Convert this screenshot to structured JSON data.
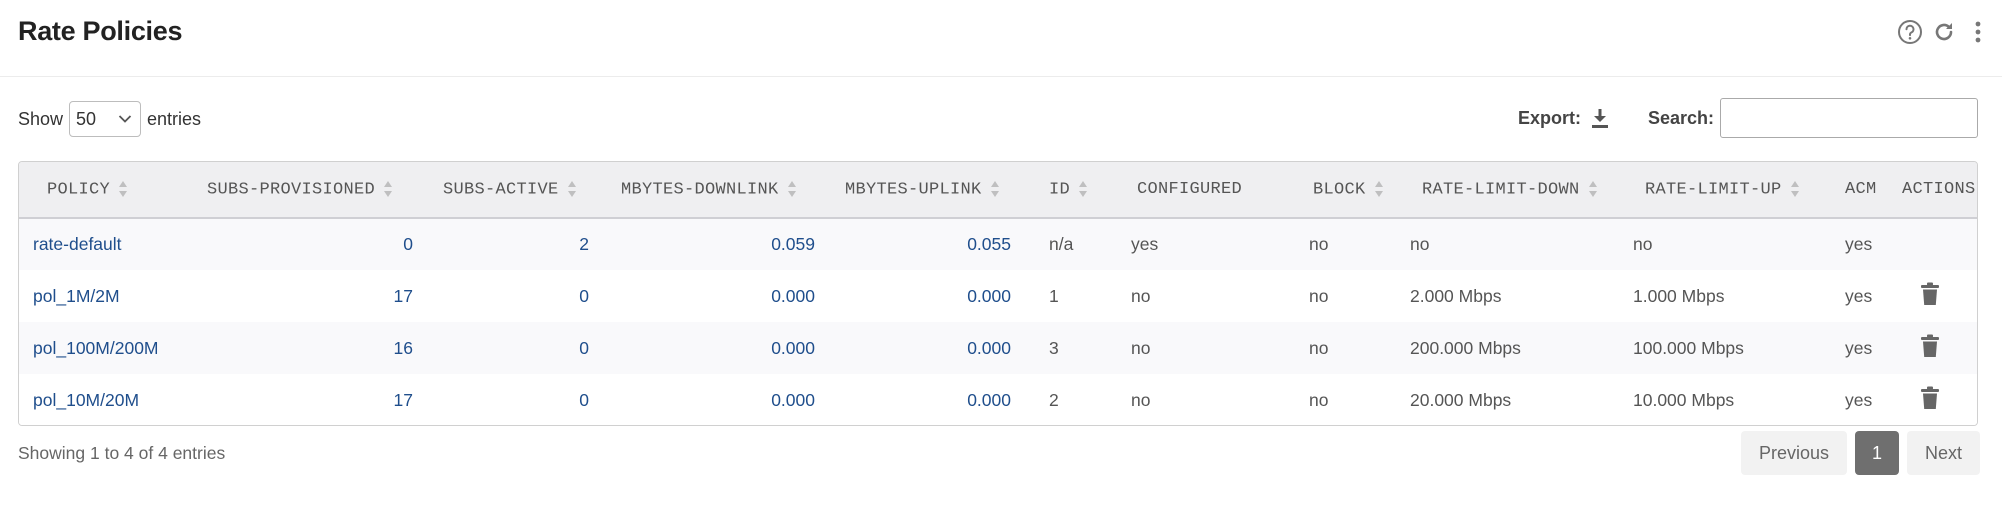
{
  "header": {
    "title": "Rate Policies"
  },
  "controls": {
    "show_label": "Show",
    "entries_value": "50",
    "entries_label": "entries",
    "export_label": "Export:",
    "search_label": "Search:",
    "search_value": ""
  },
  "table": {
    "columns": [
      "POLICY",
      "SUBS-PROVISIONED",
      "SUBS-ACTIVE",
      "MBYTES-DOWNLINK",
      "MBYTES-UPLINK",
      "ID",
      "CONFIGURED",
      "BLOCK",
      "RATE-LIMIT-DOWN",
      "RATE-LIMIT-UP",
      "ACM",
      "ACTIONS"
    ],
    "rows": [
      {
        "policy": "rate-default",
        "subs_provisioned": "0",
        "subs_active": "2",
        "mbytes_downlink": "0.059",
        "mbytes_uplink": "0.055",
        "id": "n/a",
        "configured": "yes",
        "block": "no",
        "rate_limit_down": "no",
        "rate_limit_up": "no",
        "acm": "yes"
      },
      {
        "policy": "pol_1M/2M",
        "subs_provisioned": "17",
        "subs_active": "0",
        "mbytes_downlink": "0.000",
        "mbytes_uplink": "0.000",
        "id": "1",
        "configured": "no",
        "block": "no",
        "rate_limit_down": "2.000 Mbps",
        "rate_limit_up": "1.000 Mbps",
        "acm": "yes"
      },
      {
        "policy": "pol_100M/200M",
        "subs_provisioned": "16",
        "subs_active": "0",
        "mbytes_downlink": "0.000",
        "mbytes_uplink": "0.000",
        "id": "3",
        "configured": "no",
        "block": "no",
        "rate_limit_down": "200.000 Mbps",
        "rate_limit_up": "100.000 Mbps",
        "acm": "yes"
      },
      {
        "policy": "pol_10M/20M",
        "subs_provisioned": "17",
        "subs_active": "0",
        "mbytes_downlink": "0.000",
        "mbytes_uplink": "0.000",
        "id": "2",
        "configured": "no",
        "block": "no",
        "rate_limit_down": "20.000 Mbps",
        "rate_limit_up": "10.000 Mbps",
        "acm": "yes"
      }
    ]
  },
  "footer": {
    "info": "Showing 1 to 4 of 4 entries",
    "previous_label": "Previous",
    "page_label": "1",
    "next_label": "Next"
  },
  "colors": {
    "link": "#1f4e8c",
    "header_bg": "#efeff1",
    "active_page": "#6f6f6f"
  }
}
